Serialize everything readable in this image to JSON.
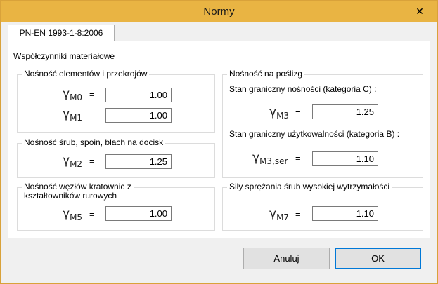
{
  "window": {
    "title": "Normy",
    "close_glyph": "✕"
  },
  "tab": {
    "label": "PN-EN 1993-1-8:2006"
  },
  "section_label": "Współczynniki materiałowe",
  "groups": {
    "elements": {
      "title": "Nośność elementów i przekrojów",
      "rows": [
        {
          "symbol": "γ",
          "sub": "M0",
          "eq": "=",
          "value": "1.00"
        },
        {
          "symbol": "γ",
          "sub": "M1",
          "eq": "=",
          "value": "1.00"
        }
      ]
    },
    "bolts": {
      "title": "Nośność śrub, spoin, blach na docisk",
      "rows": [
        {
          "symbol": "γ",
          "sub": "M2",
          "eq": "=",
          "value": "1.25"
        }
      ]
    },
    "truss": {
      "title_line1": "Nośność węzłów kratownic z",
      "title_line2": "kształtowników rurowych",
      "rows": [
        {
          "symbol": "γ",
          "sub": "M5",
          "eq": "=",
          "value": "1.00"
        }
      ]
    },
    "slip": {
      "title": "Nośność na poślizg",
      "uls_label": "Stan graniczny nośności (kategoria C) :",
      "uls_row": {
        "symbol": "γ",
        "sub": "M3",
        "eq": "=",
        "value": "1.25"
      },
      "sls_label": "Stan graniczny użytkowalności (kategoria B) :",
      "sls_row": {
        "symbol": "γ",
        "sub": "M3,ser",
        "eq": "=",
        "value": "1.10"
      }
    },
    "preload": {
      "title": "Siły sprężania śrub wysokiej wytrzymałości",
      "rows": [
        {
          "symbol": "γ",
          "sub": "M7",
          "eq": "=",
          "value": "1.10"
        }
      ]
    }
  },
  "buttons": {
    "cancel": "Anuluj",
    "ok": "OK"
  },
  "colors": {
    "titlebar": "#e9b443",
    "panel": "#ffffff",
    "dialog_bg": "#f0f0f0"
  }
}
